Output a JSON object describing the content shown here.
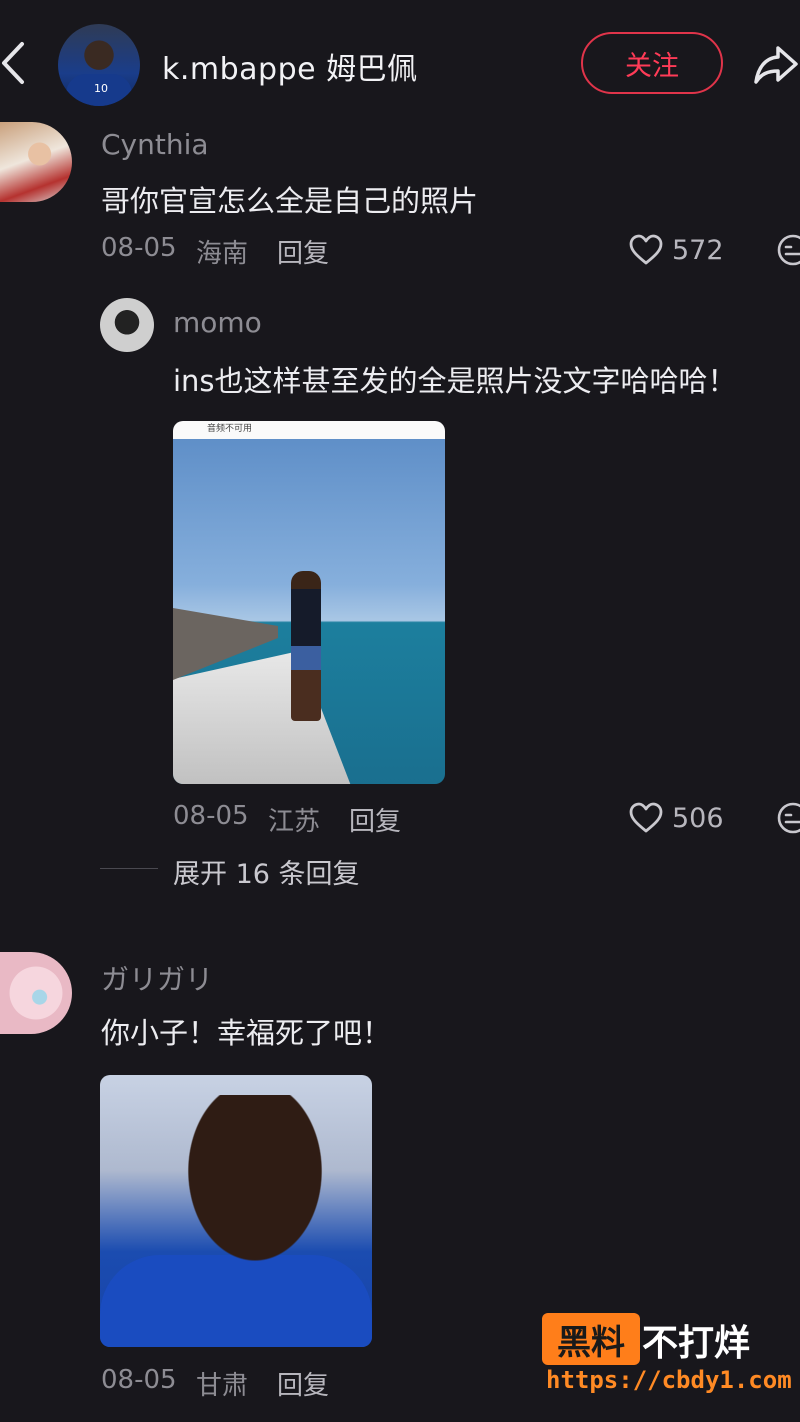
{
  "header": {
    "title": "k.mbappe 姆巴佩",
    "follow_label": "关注",
    "avatar_number": "10"
  },
  "comments": [
    {
      "name": "Cynthia",
      "text": "哥你官宣怎么全是自己的照片",
      "date": "08-05",
      "location": "海南",
      "reply_label": "回复",
      "likes": "572",
      "replies": [
        {
          "name": "momo",
          "text": "ins也这样甚至发的全是照片没文字哈哈哈！",
          "image_caption": "音频不可用",
          "date": "08-05",
          "location": "江苏",
          "reply_label": "回复",
          "likes": "506"
        }
      ],
      "expand_label": "展开 16 条回复"
    },
    {
      "name": "ガリガリ",
      "text": "你小子！幸福死了吧！",
      "date": "08-05",
      "location": "甘肃",
      "reply_label": "回复"
    }
  ],
  "watermark": {
    "box_text": "黑料",
    "text": "不打烊",
    "url": "https://cbdy1.com"
  },
  "colors": {
    "background": "#18171c",
    "accent": "#ff3b57",
    "watermark": "#ff7e1a"
  },
  "icons": [
    "back-icon",
    "share-icon",
    "heart-icon",
    "dislike-icon"
  ]
}
